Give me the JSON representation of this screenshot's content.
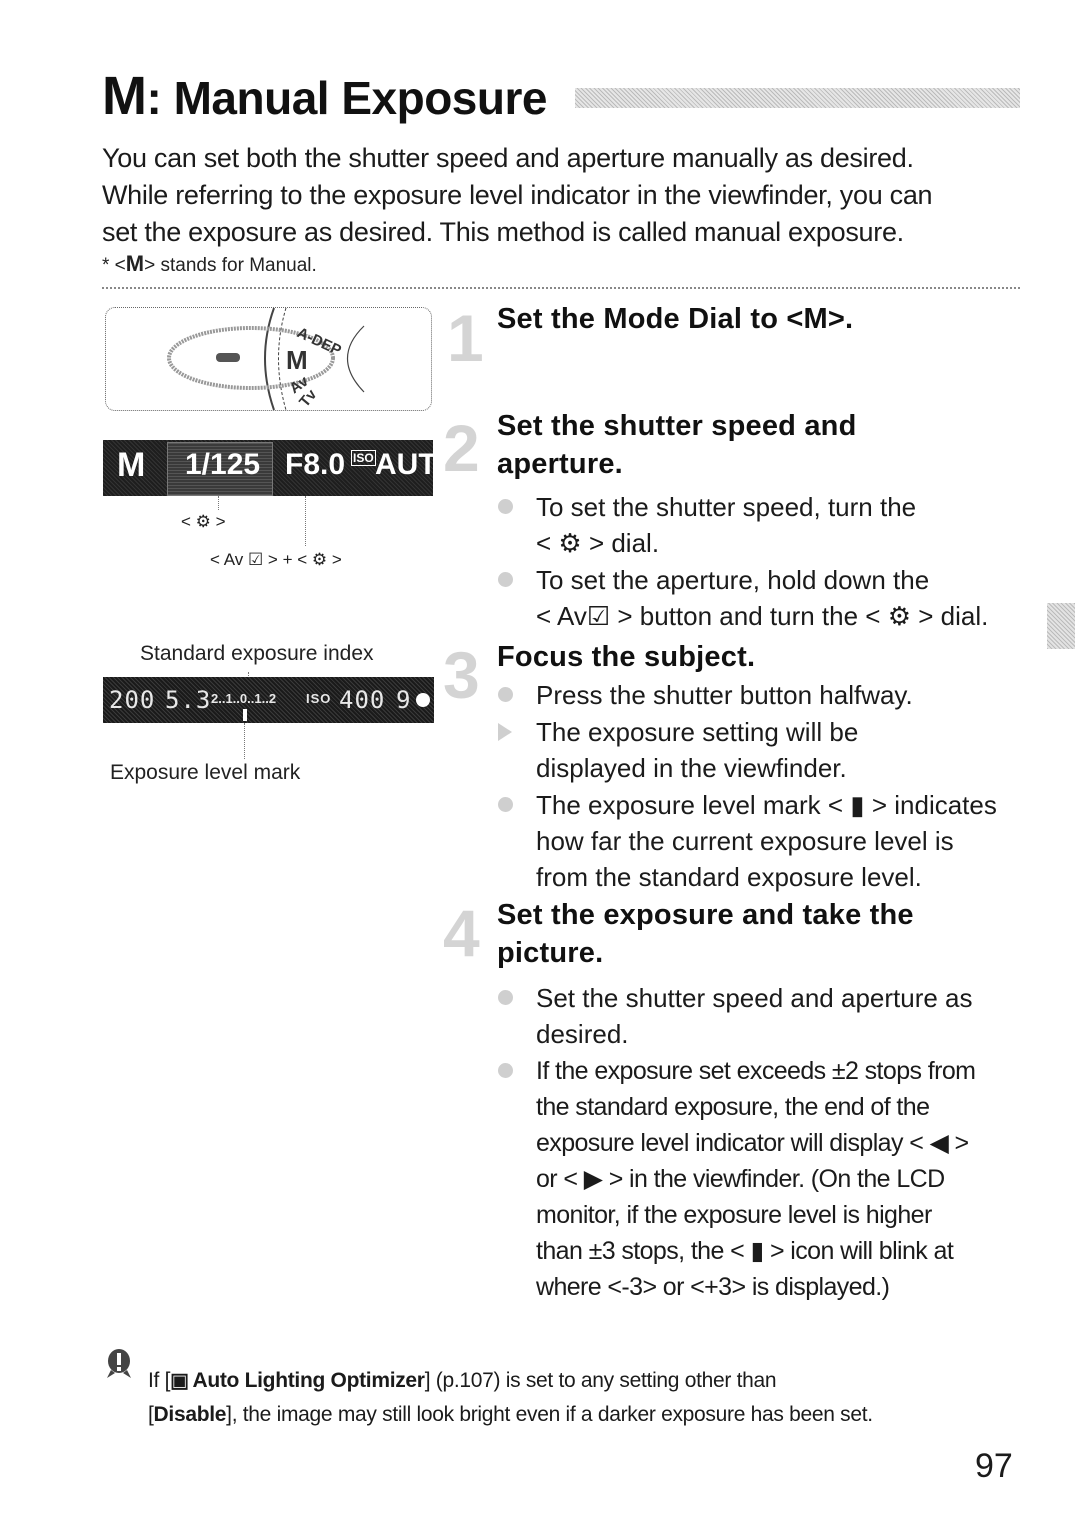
{
  "title": {
    "mode_letter": "M",
    "separator": ": ",
    "text": "Manual Exposure"
  },
  "intro": {
    "lines": [
      "You can set both the shutter speed and aperture manually as desired.",
      "While referring to the exposure level indicator in the viewfinder, you can",
      "set the exposure as desired. This method is called manual exposure."
    ],
    "footnote_prefix": "* <",
    "footnote_mode": "M",
    "footnote_suffix": "> stands for Manual."
  },
  "illustrations": {
    "mode_dial": {
      "selected": "M",
      "labels": [
        "A-DEP",
        "M",
        "Av",
        "Tv"
      ]
    },
    "lcd_panel": {
      "mode": "M",
      "shutter": "1/125",
      "aperture": "F8.0",
      "iso_label": "ISO",
      "iso_value": "AUTO"
    },
    "lcd_callouts": {
      "dial_label": "< ⚙ >",
      "av_label": "< Av ☑ > + < ⚙ >"
    },
    "viewfinder": {
      "caption_top": "Standard exposure index",
      "shutter": "200",
      "aperture": "5.3",
      "scale": "2..1..0..1..2",
      "iso_label": "ISO",
      "iso_value": "400",
      "shots": "9",
      "caption_bottom": "Exposure level mark"
    }
  },
  "steps": [
    {
      "number": "1",
      "heading": "Set the Mode Dial to <M>.",
      "bullets": []
    },
    {
      "number": "2",
      "heading_lines": [
        "Set the shutter speed and",
        "aperture."
      ],
      "bullets": [
        {
          "type": "dot",
          "lines": [
            "To set the shutter speed, turn the",
            "< ⚙ > dial."
          ]
        },
        {
          "type": "dot",
          "lines": [
            "To set the aperture, hold down the",
            "< Av☑ > button and turn the < ⚙ > dial."
          ]
        }
      ]
    },
    {
      "number": "3",
      "heading": "Focus the subject.",
      "bullets": [
        {
          "type": "dot",
          "lines": [
            "Press the shutter button halfway."
          ]
        },
        {
          "type": "arrow",
          "lines": [
            "The exposure setting will be",
            "displayed in the viewfinder."
          ]
        },
        {
          "type": "dot",
          "lines": [
            "The exposure level mark < ▮ > indicates",
            "how far the current exposure level is",
            "from the standard exposure level."
          ]
        }
      ]
    },
    {
      "number": "4",
      "heading_lines": [
        "Set the exposure and take the",
        "picture."
      ],
      "bullets": [
        {
          "type": "dot",
          "lines": [
            "Set the shutter speed and aperture as",
            "desired."
          ]
        },
        {
          "type": "dot",
          "lines": [
            "If the exposure set exceeds ±2 stops from",
            "the standard exposure, the end of the",
            "exposure level indicator will display < ◀ >",
            "or < ▶ > in the viewfinder. (On the LCD",
            "monitor, if the exposure level is higher",
            "than ±3 stops, the < ▮ > icon will blink at",
            "where <-3> or <+3> is displayed.)"
          ]
        }
      ]
    }
  ],
  "caution": {
    "icon": "caution-icon",
    "line1_prefix": "If [",
    "line1_bold": "Auto Lighting Optimizer",
    "line1_suffix": "] (p.107) is set to any setting other than",
    "line2_bold": "Disable",
    "line2_suffix": "], the image may still look bright even if a darker exposure has been set.",
    "line2_prefix": "["
  },
  "page_number": "97"
}
